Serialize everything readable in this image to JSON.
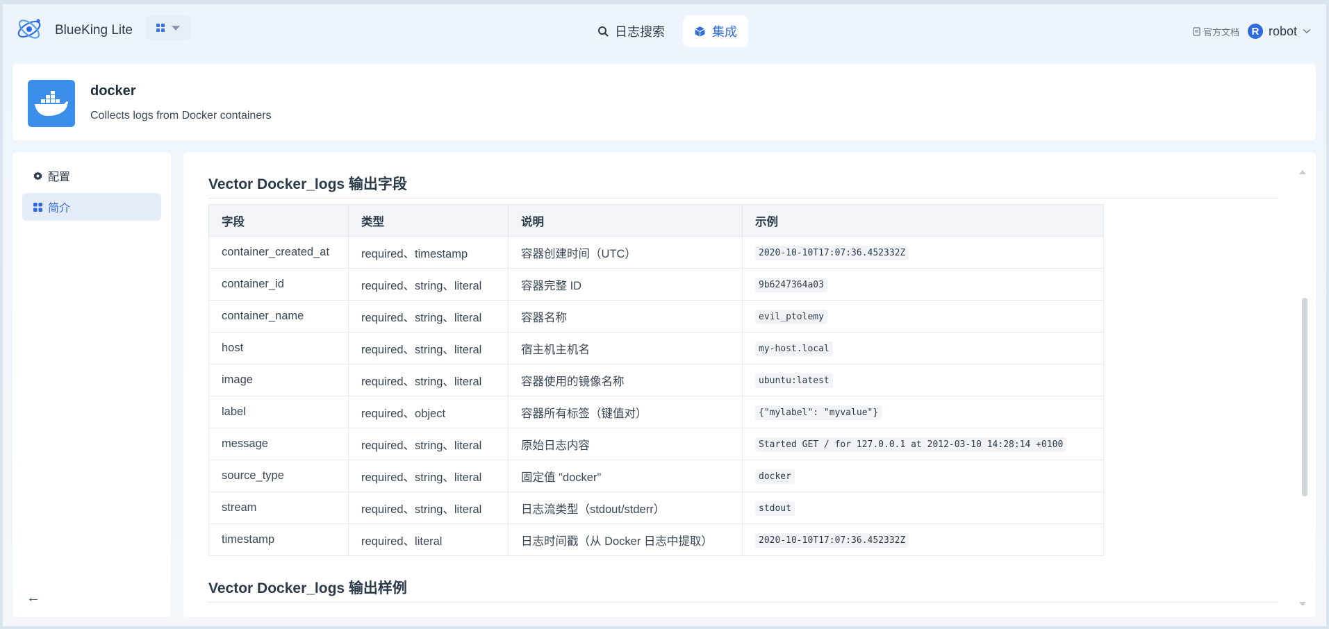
{
  "header": {
    "brand": "BlueKing Lite",
    "nav": [
      {
        "label": "日志搜索",
        "icon": "search-icon",
        "active": false
      },
      {
        "label": "集成",
        "icon": "cube-icon",
        "active": true
      }
    ],
    "docs_label": "官方文档",
    "user_initial": "R",
    "user_name": "robot"
  },
  "integration": {
    "title": "docker",
    "description": "Collects logs from Docker containers"
  },
  "sidebar": {
    "items": [
      {
        "label": "配置",
        "icon": "gear-icon",
        "active": false
      },
      {
        "label": "简介",
        "icon": "grid-icon",
        "active": true
      }
    ]
  },
  "main": {
    "section1_title": "Vector Docker_logs 输出字段",
    "section2_title": "Vector Docker_logs 输出样例",
    "table": {
      "headers": [
        "字段",
        "类型",
        "说明",
        "示例"
      ],
      "rows": [
        {
          "field": "container_created_at",
          "type": "required、timestamp",
          "desc": "容器创建时间（UTC）",
          "example": "2020-10-10T17:07:36.452332Z"
        },
        {
          "field": "container_id",
          "type": "required、string、literal",
          "desc": "容器完整 ID",
          "example": "9b6247364a03"
        },
        {
          "field": "container_name",
          "type": "required、string、literal",
          "desc": "容器名称",
          "example": "evil_ptolemy"
        },
        {
          "field": "host",
          "type": "required、string、literal",
          "desc": "宿主机主机名",
          "example": "my-host.local"
        },
        {
          "field": "image",
          "type": "required、string、literal",
          "desc": "容器使用的镜像名称",
          "example": "ubuntu:latest"
        },
        {
          "field": "label",
          "type": "required、object",
          "desc": "容器所有标签（键值对）",
          "example": "{\"mylabel\": \"myvalue\"}"
        },
        {
          "field": "message",
          "type": "required、string、literal",
          "desc": "原始日志内容",
          "example": "Started GET / for 127.0.0.1 at 2012-03-10 14:28:14 +0100"
        },
        {
          "field": "source_type",
          "type": "required、string、literal",
          "desc": "固定值 \"docker\"",
          "example": "docker"
        },
        {
          "field": "stream",
          "type": "required、string、literal",
          "desc": "日志流类型（stdout/stderr）",
          "example": "stdout"
        },
        {
          "field": "timestamp",
          "type": "required、literal",
          "desc": "日志时间戳（从 Docker 日志中提取）",
          "example": "2020-10-10T17:07:36.452332Z"
        }
      ]
    }
  },
  "colors": {
    "accent": "#2f6be0",
    "docker_blue": "#3a8de8"
  }
}
